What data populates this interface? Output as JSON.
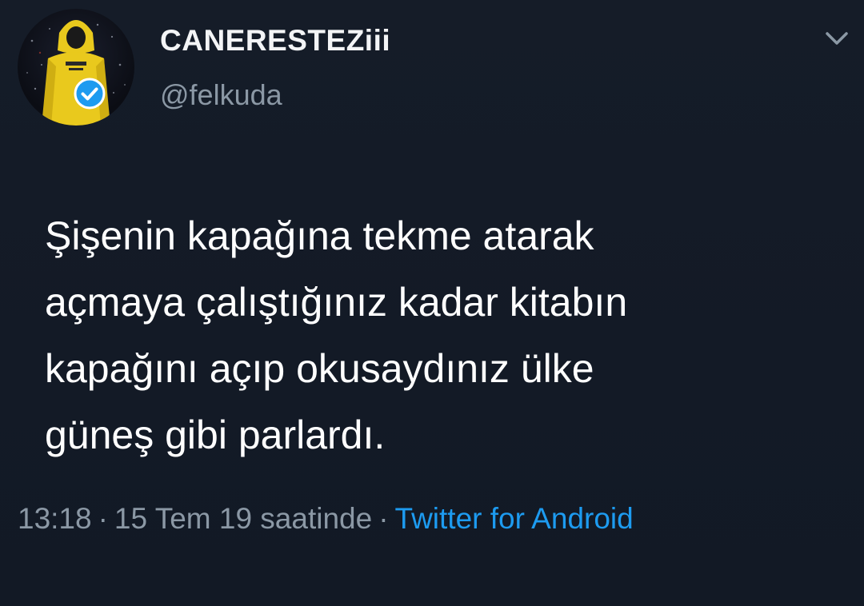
{
  "user": {
    "display_name": "CANERESTEZiii",
    "handle": "@felkuda",
    "verified": true,
    "avatar_icon": "yellow-hoodie-avatar"
  },
  "menu": {
    "icon": "chevron-down-icon"
  },
  "tweet": {
    "lines": [
      "Şişenin kapağına tekme atarak",
      "açmaya çalıştığınız kadar kitabın",
      "kapağını açıp okusaydınız ülke",
      "güneş gibi parlardı."
    ]
  },
  "meta": {
    "time": "13:18",
    "separator": "·",
    "date": "15 Tem 19 saatinde",
    "source": "Twitter for Android"
  },
  "colors": {
    "background": "#141b27",
    "muted": "#8b98a5",
    "link": "#1d9bf0",
    "verified_badge": "#1d9bf0",
    "hoodie": "#e9c91d"
  }
}
